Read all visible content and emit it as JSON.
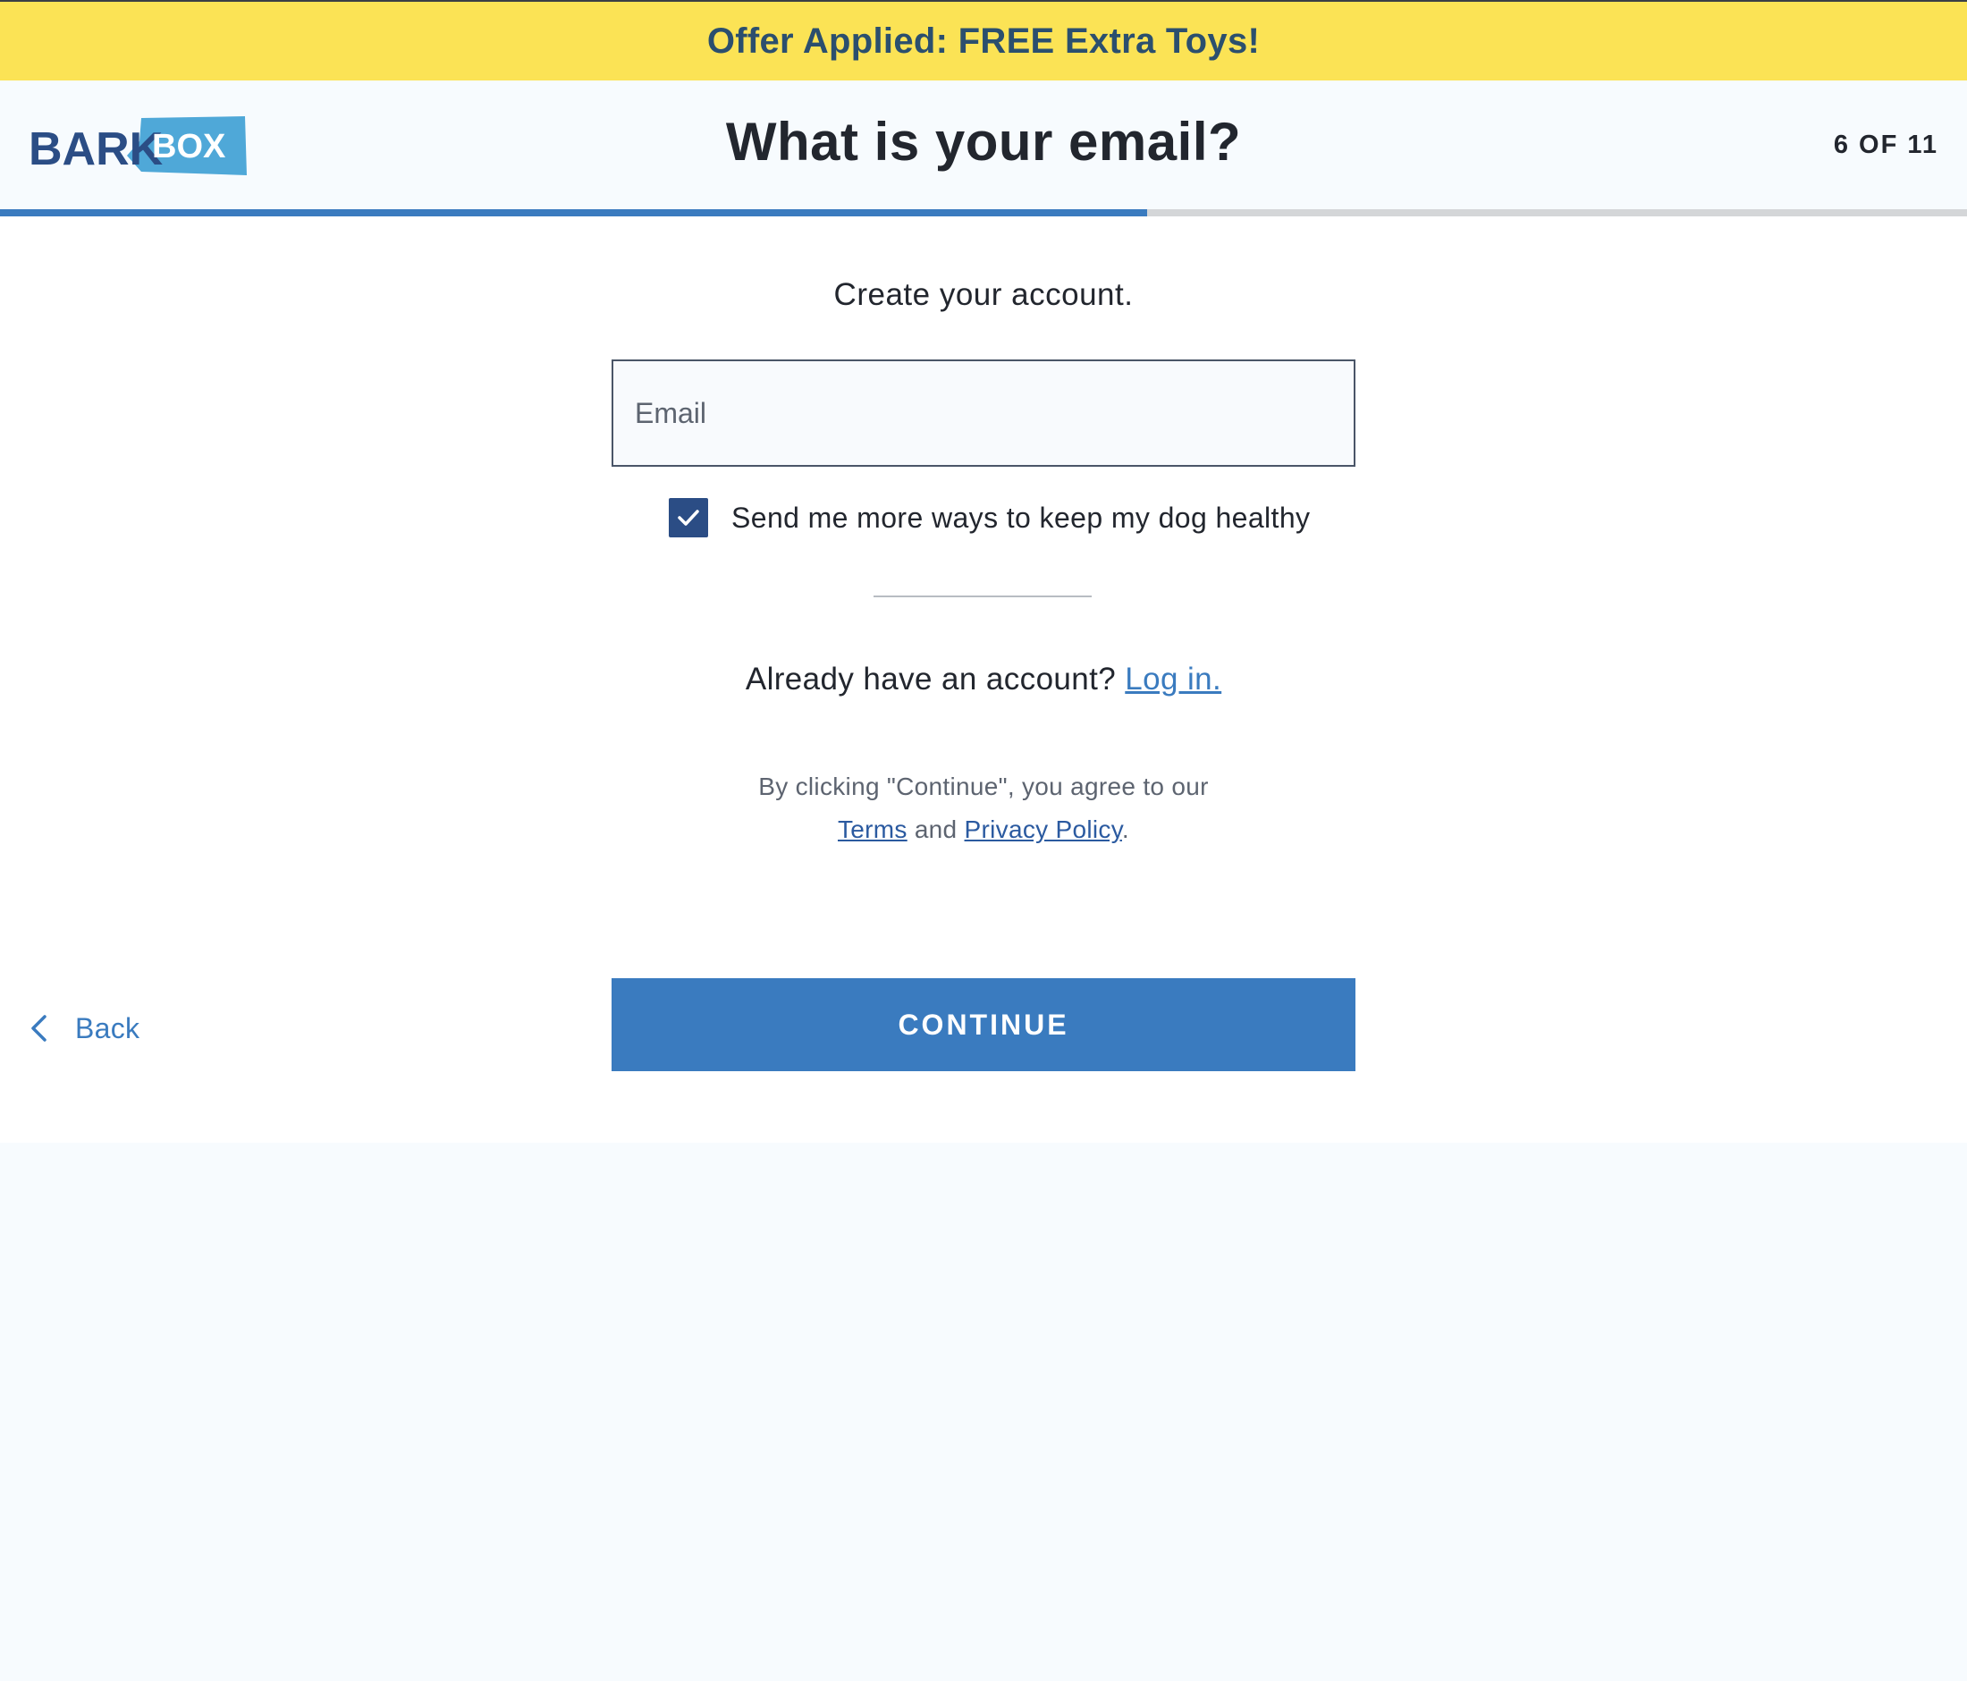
{
  "promo": {
    "text": "Offer Applied: FREE Extra Toys!"
  },
  "header": {
    "logo": {
      "word_left": "BARK",
      "word_right": "BOX"
    },
    "title": "What is your email?",
    "step": "6 OF 11"
  },
  "progress": {
    "current": 6,
    "total": 11,
    "fraction": 0.583
  },
  "form": {
    "subtitle": "Create your account.",
    "email": {
      "value": "",
      "placeholder": "Email"
    },
    "opt_in": {
      "checked": true,
      "label": "Send me more ways to keep my dog healthy"
    }
  },
  "login": {
    "prompt": "Already have an account?",
    "link": "Log in."
  },
  "legal": {
    "line1": "By clicking \"Continue\", you agree to our",
    "terms": "Terms",
    "and": "and",
    "privacy": "Privacy Policy",
    "period": "."
  },
  "nav": {
    "back_label": "Back",
    "continue_label": "CONTINUE"
  },
  "colors": {
    "banner": "#fbe355",
    "banner_text": "#2b4f6e",
    "accent": "#3a7bbf",
    "checkbox": "#2b4d85",
    "logo_dark": "#2b4d85",
    "logo_light": "#4fa8d8"
  },
  "icons": {
    "check": "check-icon",
    "back": "chevron-left-icon"
  }
}
